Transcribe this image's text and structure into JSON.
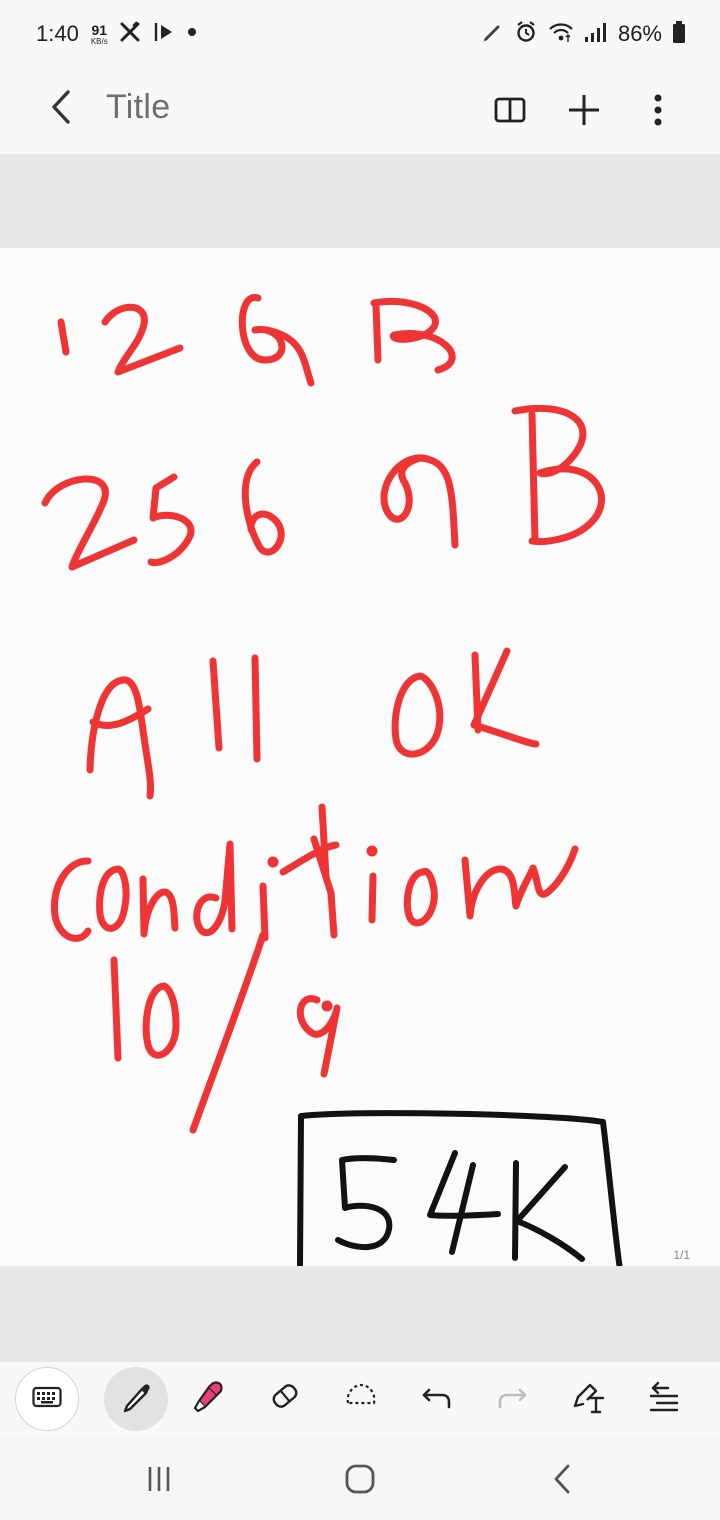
{
  "status_bar": {
    "time": "1:40",
    "network_speed": "91",
    "network_unit": "KB/s",
    "battery": "86%",
    "icons": [
      "x-icon",
      "play-icon",
      "dot-icon",
      "pen-icon",
      "alarm-icon",
      "wifi-icon",
      "signal-icon",
      "battery-icon"
    ]
  },
  "app_bar": {
    "title": "Title",
    "icons": [
      "back-icon",
      "book-icon",
      "plus-icon",
      "more-icon"
    ]
  },
  "canvas": {
    "handwriting": {
      "lines": [
        "12 GB",
        "256 GB",
        "All OK",
        "condition",
        "10/9"
      ],
      "price_box": "54K"
    },
    "page_indicator": "1/1"
  },
  "toolbar": {
    "tools": [
      "keyboard-icon",
      "pen-icon",
      "highlighter-icon",
      "eraser-icon",
      "lasso-icon",
      "undo-icon",
      "redo-icon",
      "text-icon",
      "align-icon"
    ],
    "active_tool": "pen"
  },
  "nav_bar": {
    "icons": [
      "recent-apps-icon",
      "home-icon",
      "back-icon"
    ]
  },
  "colors": {
    "ink_red": "#ef3435",
    "ink_black": "#121212",
    "highlighter": "#e93e71",
    "canvas_bg": "#fbfbfb",
    "band": "#e7e7e9"
  }
}
